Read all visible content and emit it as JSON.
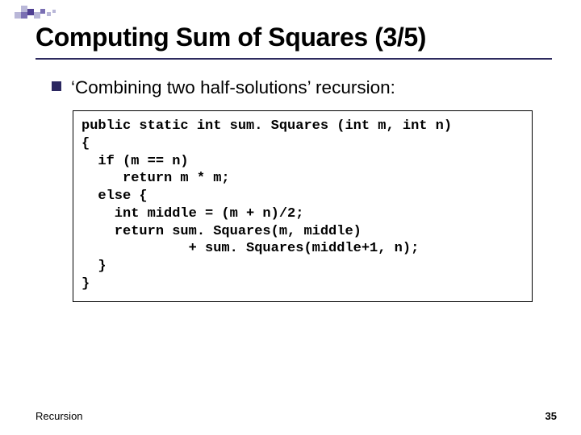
{
  "title": "Computing Sum of Squares (3/5)",
  "bullet": "‘Combining two half-solutions’ recursion:",
  "code_lines": [
    "public static int sum. Squares (int m, int n)",
    "{",
    "  if (m == n)",
    "     return m * m;",
    "  else {",
    "    int middle = (m + n)/2;",
    "    return sum. Squares(m, middle)",
    "             + sum. Squares(middle+1, n);",
    "  }",
    "}"
  ],
  "footer_left": "Recursion",
  "footer_right": "35"
}
